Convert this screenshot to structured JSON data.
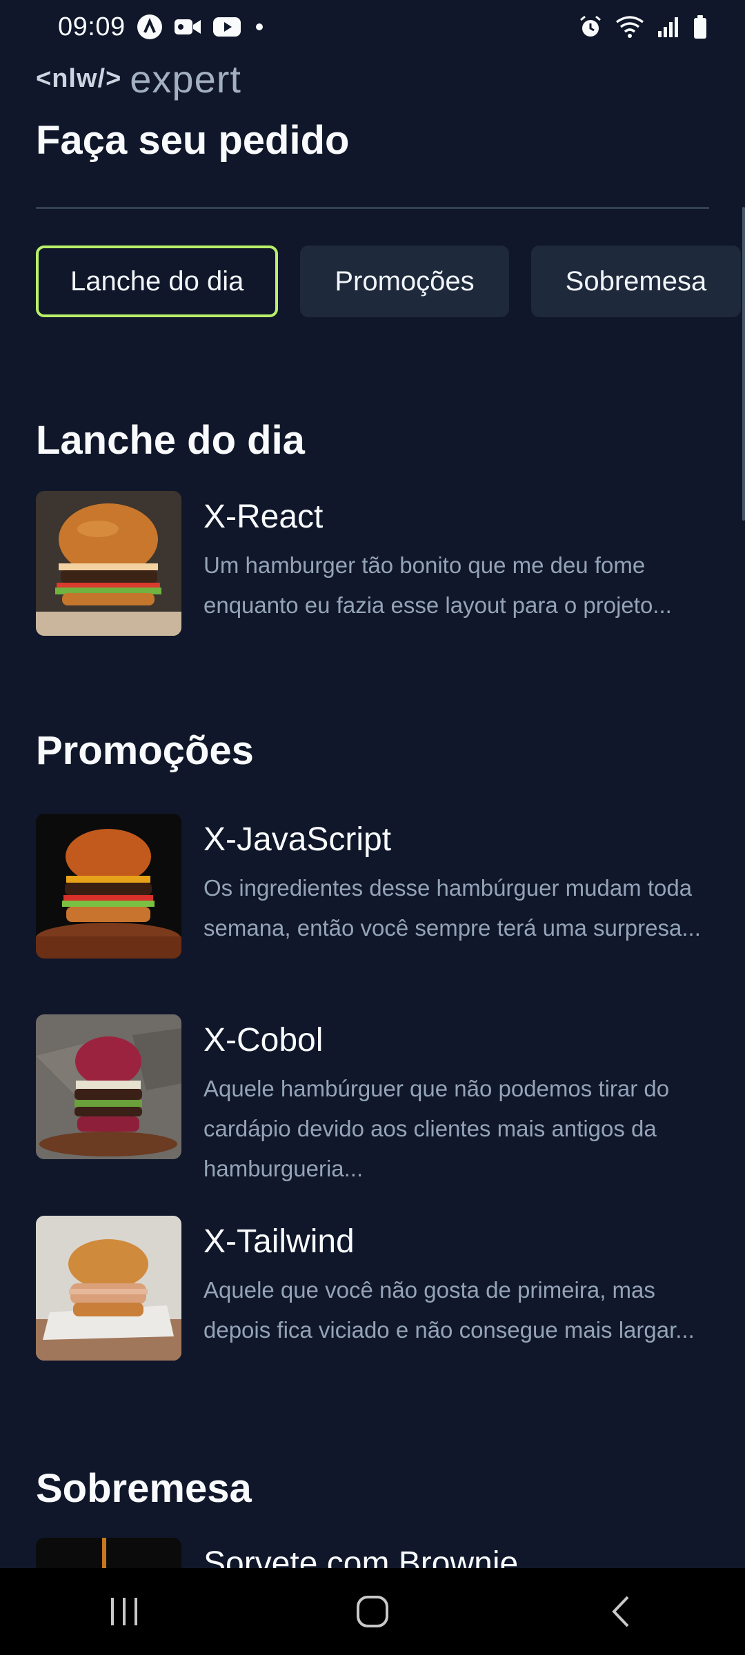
{
  "status_bar": {
    "time": "09:09",
    "left_icons": [
      "a-badge-icon",
      "video-camera-icon",
      "youtube-icon",
      "notification-dot-icon"
    ],
    "right_icons": [
      "alarm-icon",
      "wifi-icon",
      "signal-icon",
      "battery-icon"
    ]
  },
  "brand": {
    "prefix": "<nlw/>",
    "word": "expert"
  },
  "page": {
    "title": "Faça seu pedido"
  },
  "tabs": [
    {
      "label": "Lanche do dia",
      "active": true
    },
    {
      "label": "Promoções",
      "active": false
    },
    {
      "label": "Sobremesa",
      "active": false
    }
  ],
  "sections": [
    {
      "title": "Lanche do dia",
      "items": [
        {
          "title": "X-React",
          "description": "Um hamburger tão bonito que me deu fome enquanto eu fazia esse layout para o projeto..."
        }
      ]
    },
    {
      "title": "Promoções",
      "items": [
        {
          "title": "X-JavaScript",
          "description": "Os ingredientes desse hambúrguer mudam toda semana, então você sempre terá uma surpresa..."
        },
        {
          "title": "X-Cobol",
          "description": "Aquele hambúrguer que não podemos tirar do cardápio devido aos clientes mais antigos da hamburgueria..."
        },
        {
          "title": "X-Tailwind",
          "description": "Aquele que você não gosta de primeira, mas depois fica viciado e não consegue mais largar..."
        }
      ]
    },
    {
      "title": "Sobremesa",
      "items": [
        {
          "title": "Sorvete com Brownie"
        }
      ]
    }
  ],
  "colors": {
    "background": "#10172a",
    "accent": "#b9f06a",
    "card": "#1e293b",
    "muted_text": "#94a3b8"
  },
  "nav_bar": {
    "buttons": [
      "recent-apps-icon",
      "home-icon",
      "back-icon"
    ]
  }
}
